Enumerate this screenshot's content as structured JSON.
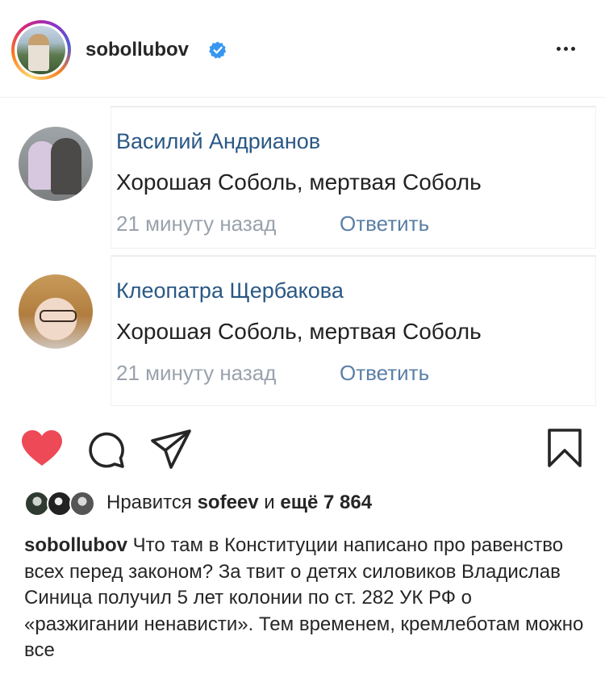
{
  "post": {
    "username": "sobollubov",
    "verified": true
  },
  "comments": [
    {
      "author": "Василий Андрианов",
      "text": "Хорошая Соболь, мертвая Соболь",
      "time": "21 минуту назад",
      "reply_label": "Ответить"
    },
    {
      "author": "Клеопатра Щербакова",
      "text": "Хорошая Соболь, мертвая Соболь",
      "time": "21 минуту назад",
      "reply_label": "Ответить"
    }
  ],
  "likes": {
    "prefix": "Нравится",
    "user": "sofeev",
    "middle": "и",
    "count_text": "ещё 7 864"
  },
  "caption": {
    "username": "sobollubov",
    "text": "Что там в Конституции написано про равенство всех перед законом? За твит о детях силовиков Владислав Синица получил 5 лет колонии по ст. 282 УК РФ о «разжигании ненависти». Тем временем, кремлеботам можно все"
  },
  "icons": {
    "like": "heart-icon",
    "comment": "comment-icon",
    "share": "share-icon",
    "save": "bookmark-icon",
    "more": "more-icon",
    "verified": "verified-badge-icon"
  },
  "colors": {
    "heart": "#ed4956",
    "verified": "#3897f0",
    "vk_name": "#2a5885",
    "vk_time": "#9aa2ac",
    "vk_reply": "#5b7fa6"
  }
}
